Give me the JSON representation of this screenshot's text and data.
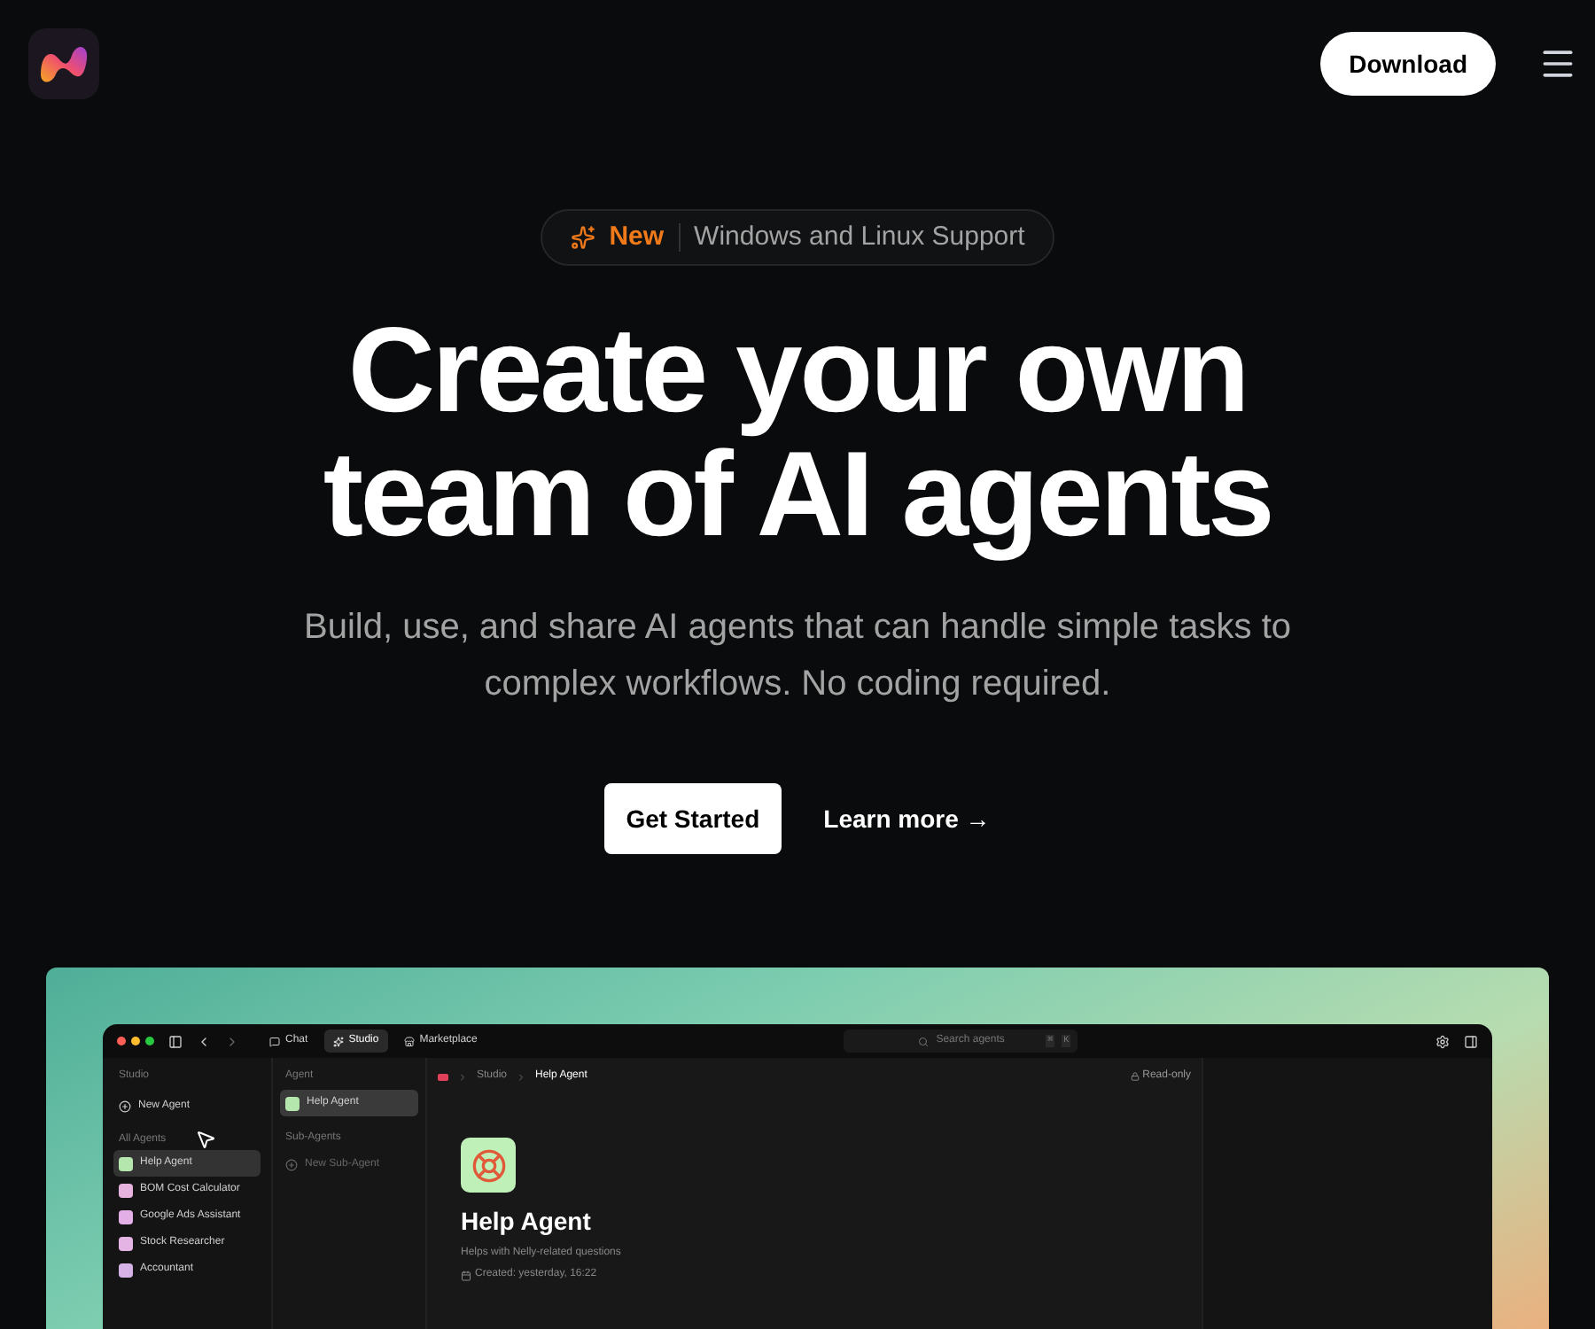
{
  "header": {
    "download_button": "Download"
  },
  "announcement": {
    "tag": "New",
    "text": "Windows and Linux Support"
  },
  "hero": {
    "title_lines": [
      "Create your own",
      "team of AI agents"
    ],
    "subtitle": "Build, use, and share AI agents that can handle simple tasks to complex workflows. No coding required.",
    "buttons": [
      {
        "label": "Get Started",
        "kind": "primary"
      },
      {
        "label": "Learn more →",
        "kind": "link"
      }
    ]
  },
  "app_preview": {
    "tabs": [
      {
        "label": "Chat",
        "selected": false
      },
      {
        "label": "Studio",
        "selected": true
      },
      {
        "label": "Marketplace",
        "selected": false
      }
    ],
    "search": {
      "placeholder": "Search agents",
      "shortcut": [
        "⌘",
        "K"
      ]
    },
    "sidebar": {
      "section_title": "Studio",
      "new_button": "New Agent",
      "group_title": "All Agents",
      "items": [
        {
          "label": "Help Agent",
          "selected": true,
          "color": "#b4e6ae"
        },
        {
          "label": "BOM Cost Calculator",
          "selected": false,
          "color": "#e6b3de"
        },
        {
          "label": "Google Ads Assistant",
          "selected": false,
          "color": "#e2b0e6"
        },
        {
          "label": "Stock Researcher",
          "selected": false,
          "color": "#e3b4e4"
        },
        {
          "label": "Accountant",
          "selected": false,
          "color": "#d6b2e6"
        }
      ]
    },
    "agent_panel": {
      "title": "Agent",
      "items": [
        {
          "label": "Help Agent",
          "selected": true
        }
      ],
      "sub_title": "Sub-Agents",
      "new_button": "New Sub-Agent"
    },
    "breadcrumb": [
      "Studio",
      "Help Agent"
    ],
    "read_only": "Read-only",
    "agent": {
      "name": "Help Agent",
      "description": "Helps with Nelly-related questions",
      "created": "Created: yesterday, 16:22"
    }
  }
}
